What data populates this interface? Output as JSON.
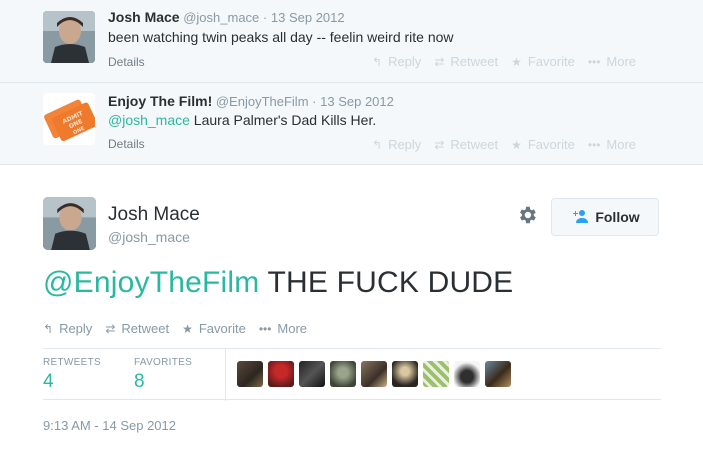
{
  "context_tweets": [
    {
      "name": "Josh Mace",
      "screen_name": "@josh_mace",
      "date": "13 Sep 2012",
      "text": "been watching twin peaks all day -- feelin weird rite now",
      "details": "Details"
    },
    {
      "name": "Enjoy The Film!",
      "screen_name": "@EnjoyTheFilm",
      "date": "13 Sep 2012",
      "mention": "@josh_mace",
      "text": " Laura Palmer's Dad Kills Her.",
      "details": "Details",
      "avatar_text": [
        "ADMIT",
        "ONE",
        "ONE"
      ]
    }
  ],
  "actions": {
    "reply": "Reply",
    "retweet": "Retweet",
    "favorite": "Favorite",
    "more": "More"
  },
  "tweet": {
    "name": "Josh Mace",
    "screen_name": "@josh_mace",
    "mention": "@EnjoyTheFilm",
    "text": " THE FUCK DUDE",
    "follow_label": "Follow",
    "retweets_label": "RETWEETS",
    "retweets_count": "4",
    "favorites_label": "FAVORITES",
    "favorites_count": "8",
    "timestamp": "9:13 AM - 14 Sep 2012"
  },
  "colors": {
    "accent": "#2ab8a0",
    "follow_icon": "#2aa3ef",
    "muted": "#8899a6",
    "context_bg": "#f5f8fa"
  },
  "icons": [
    "reply-icon",
    "retweet-icon",
    "star-icon",
    "more-dots-icon",
    "gear-icon",
    "follow-person-icon"
  ]
}
